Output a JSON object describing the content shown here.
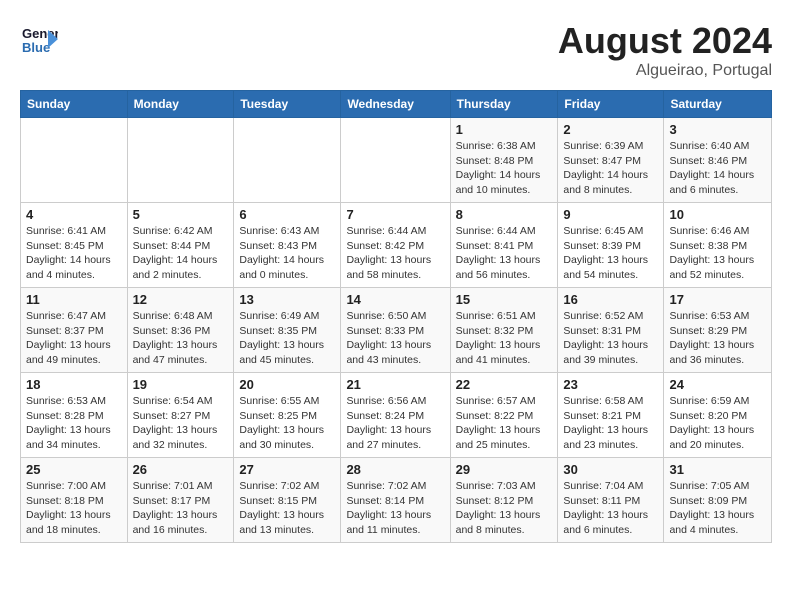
{
  "header": {
    "logo_line1": "General",
    "logo_line2": "Blue",
    "main_title": "August 2024",
    "subtitle": "Algueirao, Portugal"
  },
  "days_of_week": [
    "Sunday",
    "Monday",
    "Tuesday",
    "Wednesday",
    "Thursday",
    "Friday",
    "Saturday"
  ],
  "weeks": [
    [
      {
        "day": "",
        "info": ""
      },
      {
        "day": "",
        "info": ""
      },
      {
        "day": "",
        "info": ""
      },
      {
        "day": "",
        "info": ""
      },
      {
        "day": "1",
        "info": "Sunrise: 6:38 AM\nSunset: 8:48 PM\nDaylight: 14 hours and 10 minutes."
      },
      {
        "day": "2",
        "info": "Sunrise: 6:39 AM\nSunset: 8:47 PM\nDaylight: 14 hours and 8 minutes."
      },
      {
        "day": "3",
        "info": "Sunrise: 6:40 AM\nSunset: 8:46 PM\nDaylight: 14 hours and 6 minutes."
      }
    ],
    [
      {
        "day": "4",
        "info": "Sunrise: 6:41 AM\nSunset: 8:45 PM\nDaylight: 14 hours and 4 minutes."
      },
      {
        "day": "5",
        "info": "Sunrise: 6:42 AM\nSunset: 8:44 PM\nDaylight: 14 hours and 2 minutes."
      },
      {
        "day": "6",
        "info": "Sunrise: 6:43 AM\nSunset: 8:43 PM\nDaylight: 14 hours and 0 minutes."
      },
      {
        "day": "7",
        "info": "Sunrise: 6:44 AM\nSunset: 8:42 PM\nDaylight: 13 hours and 58 minutes."
      },
      {
        "day": "8",
        "info": "Sunrise: 6:44 AM\nSunset: 8:41 PM\nDaylight: 13 hours and 56 minutes."
      },
      {
        "day": "9",
        "info": "Sunrise: 6:45 AM\nSunset: 8:39 PM\nDaylight: 13 hours and 54 minutes."
      },
      {
        "day": "10",
        "info": "Sunrise: 6:46 AM\nSunset: 8:38 PM\nDaylight: 13 hours and 52 minutes."
      }
    ],
    [
      {
        "day": "11",
        "info": "Sunrise: 6:47 AM\nSunset: 8:37 PM\nDaylight: 13 hours and 49 minutes."
      },
      {
        "day": "12",
        "info": "Sunrise: 6:48 AM\nSunset: 8:36 PM\nDaylight: 13 hours and 47 minutes."
      },
      {
        "day": "13",
        "info": "Sunrise: 6:49 AM\nSunset: 8:35 PM\nDaylight: 13 hours and 45 minutes."
      },
      {
        "day": "14",
        "info": "Sunrise: 6:50 AM\nSunset: 8:33 PM\nDaylight: 13 hours and 43 minutes."
      },
      {
        "day": "15",
        "info": "Sunrise: 6:51 AM\nSunset: 8:32 PM\nDaylight: 13 hours and 41 minutes."
      },
      {
        "day": "16",
        "info": "Sunrise: 6:52 AM\nSunset: 8:31 PM\nDaylight: 13 hours and 39 minutes."
      },
      {
        "day": "17",
        "info": "Sunrise: 6:53 AM\nSunset: 8:29 PM\nDaylight: 13 hours and 36 minutes."
      }
    ],
    [
      {
        "day": "18",
        "info": "Sunrise: 6:53 AM\nSunset: 8:28 PM\nDaylight: 13 hours and 34 minutes."
      },
      {
        "day": "19",
        "info": "Sunrise: 6:54 AM\nSunset: 8:27 PM\nDaylight: 13 hours and 32 minutes."
      },
      {
        "day": "20",
        "info": "Sunrise: 6:55 AM\nSunset: 8:25 PM\nDaylight: 13 hours and 30 minutes."
      },
      {
        "day": "21",
        "info": "Sunrise: 6:56 AM\nSunset: 8:24 PM\nDaylight: 13 hours and 27 minutes."
      },
      {
        "day": "22",
        "info": "Sunrise: 6:57 AM\nSunset: 8:22 PM\nDaylight: 13 hours and 25 minutes."
      },
      {
        "day": "23",
        "info": "Sunrise: 6:58 AM\nSunset: 8:21 PM\nDaylight: 13 hours and 23 minutes."
      },
      {
        "day": "24",
        "info": "Sunrise: 6:59 AM\nSunset: 8:20 PM\nDaylight: 13 hours and 20 minutes."
      }
    ],
    [
      {
        "day": "25",
        "info": "Sunrise: 7:00 AM\nSunset: 8:18 PM\nDaylight: 13 hours and 18 minutes."
      },
      {
        "day": "26",
        "info": "Sunrise: 7:01 AM\nSunset: 8:17 PM\nDaylight: 13 hours and 16 minutes."
      },
      {
        "day": "27",
        "info": "Sunrise: 7:02 AM\nSunset: 8:15 PM\nDaylight: 13 hours and 13 minutes."
      },
      {
        "day": "28",
        "info": "Sunrise: 7:02 AM\nSunset: 8:14 PM\nDaylight: 13 hours and 11 minutes."
      },
      {
        "day": "29",
        "info": "Sunrise: 7:03 AM\nSunset: 8:12 PM\nDaylight: 13 hours and 8 minutes."
      },
      {
        "day": "30",
        "info": "Sunrise: 7:04 AM\nSunset: 8:11 PM\nDaylight: 13 hours and 6 minutes."
      },
      {
        "day": "31",
        "info": "Sunrise: 7:05 AM\nSunset: 8:09 PM\nDaylight: 13 hours and 4 minutes."
      }
    ]
  ]
}
